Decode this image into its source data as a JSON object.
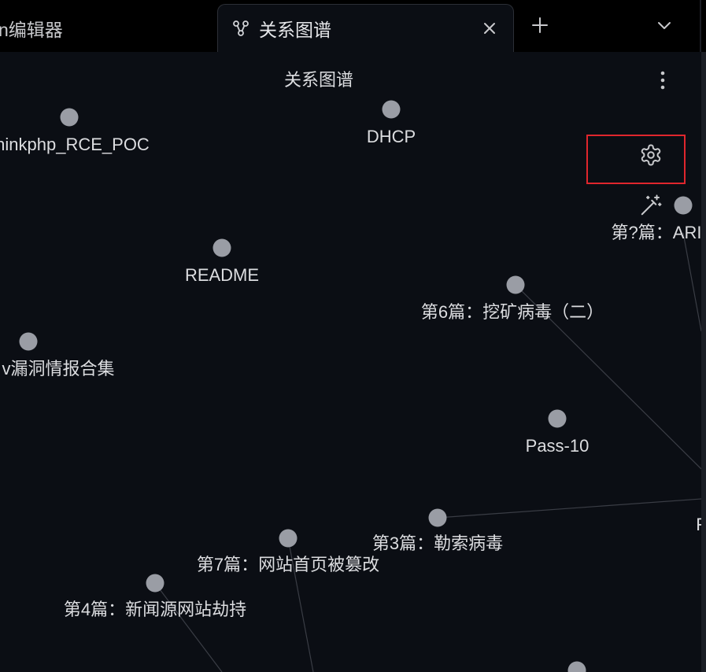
{
  "tabs": [
    {
      "label": "n编辑器",
      "active": false
    },
    {
      "label": "关系图谱",
      "active": true
    }
  ],
  "view": {
    "title": "关系图谱"
  },
  "icons": {
    "tab_graph": "graph-icon",
    "tab_close": "close-icon",
    "new_tab": "plus-icon",
    "tab_list": "chevron-down-icon",
    "more": "more-vertical-icon",
    "settings": "gear-icon",
    "animate": "magic-wand-icon"
  },
  "colors": {
    "background": "#0b0e14",
    "tabbar": "#000000",
    "node": "#9a9da5",
    "edge": "#3a3d45",
    "label": "#dcdde0",
    "highlight": "#e0262d"
  },
  "graph": {
    "nodes": [
      {
        "label": "hinkphp_RCE_POC"
      },
      {
        "label": "DHCP"
      },
      {
        "label": "第?篇：ARI"
      },
      {
        "label": "README"
      },
      {
        "label": "第6篇：挖矿病毒（二）"
      },
      {
        "label": "v漏洞情报合集"
      },
      {
        "label": "Pass-10"
      },
      {
        "label": "第3篇：勒索病毒"
      },
      {
        "label": "F"
      },
      {
        "label": "第7篇：网站首页被篡改"
      },
      {
        "label": "第4篇：新闻源网站劫持"
      },
      {
        "label": ""
      }
    ]
  }
}
